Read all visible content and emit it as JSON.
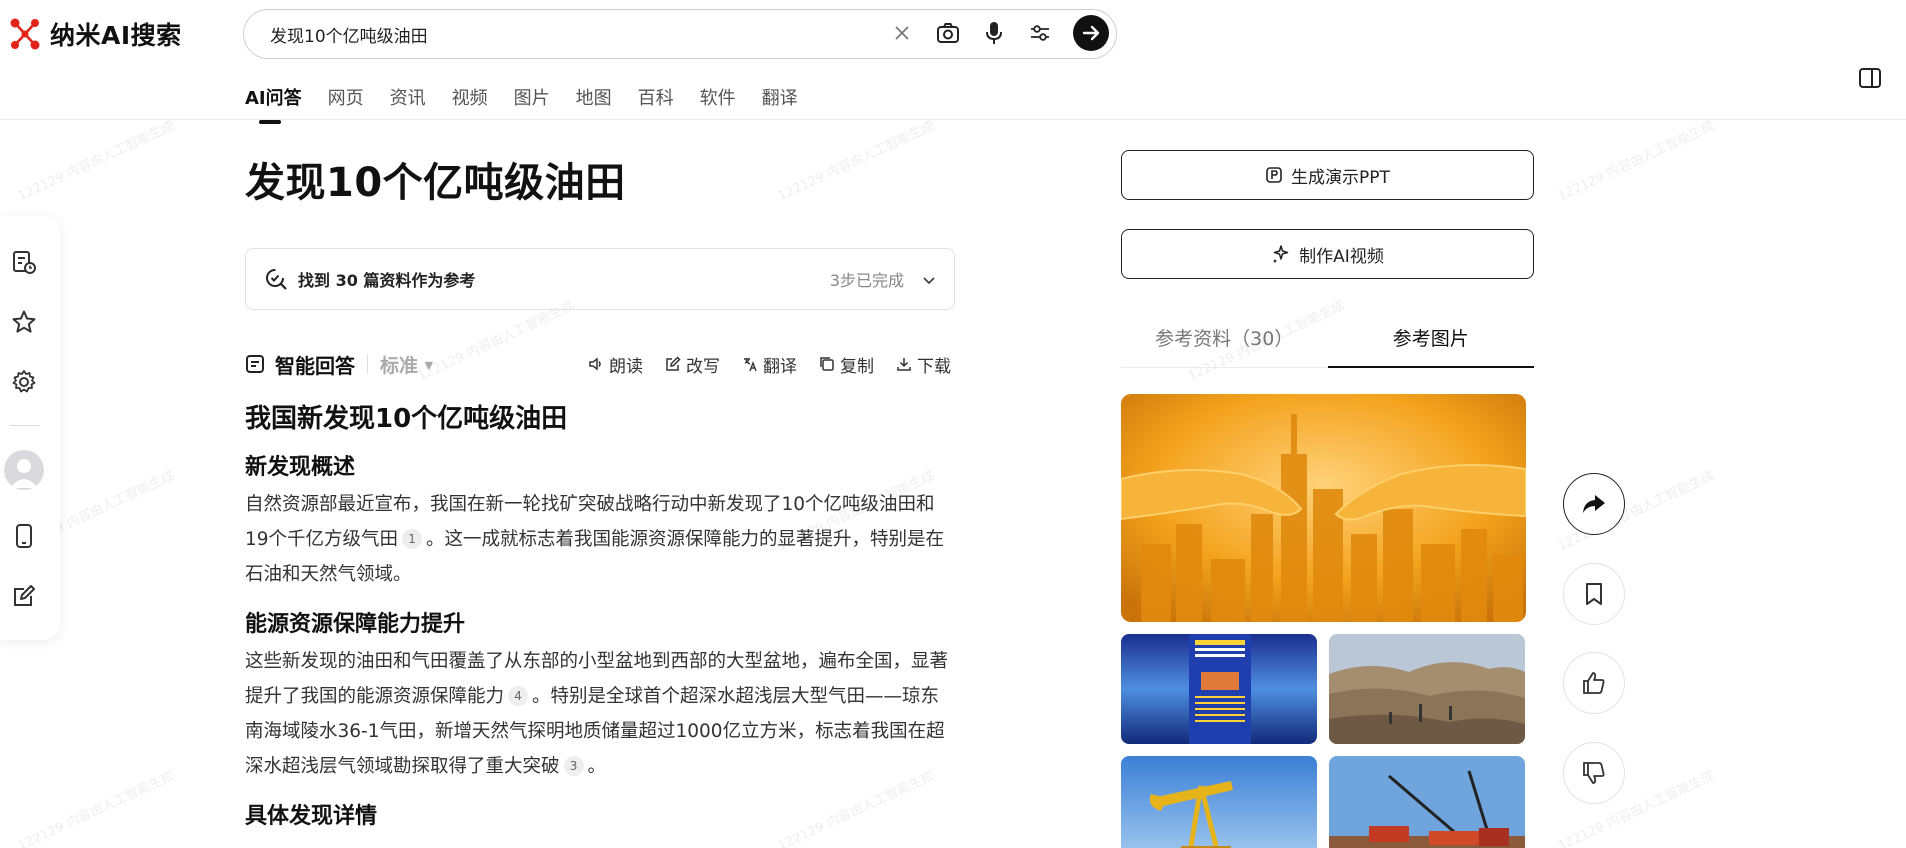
{
  "app": {
    "name": "纳米AI搜索"
  },
  "search": {
    "query": "发现10个亿吨级油田",
    "placeholder": ""
  },
  "tabs": [
    {
      "label": "AI问答",
      "active": true
    },
    {
      "label": "网页"
    },
    {
      "label": "资讯"
    },
    {
      "label": "视频"
    },
    {
      "label": "图片"
    },
    {
      "label": "地图"
    },
    {
      "label": "百科"
    },
    {
      "label": "软件"
    },
    {
      "label": "翻译"
    }
  ],
  "page": {
    "title": "发现10个亿吨级油田"
  },
  "refs": {
    "text": "找到 30 篇资料作为参考",
    "status": "3步已完成"
  },
  "answer": {
    "title": "智能回答",
    "mode": "标准",
    "actions": [
      "朗读",
      "改写",
      "翻译",
      "复制",
      "下载"
    ]
  },
  "content": {
    "h1": "我国新发现10个亿吨级油田",
    "sections": [
      {
        "heading": "新发现概述",
        "text_a": "自然资源部最近宣布，我国在新一轮找矿突破战略行动中新发现了10个亿吨级油田和19个千亿方级气田",
        "cite_a": "1",
        "text_b": "。这一成就标志着我国能源资源保障能力的显著提升，特别是在石油和天然气领域。"
      },
      {
        "heading": "能源资源保障能力提升",
        "text_a": "这些新发现的油田和气田覆盖了从东部的小型盆地到西部的大型盆地，遍布全国，显著提升了我国的能源资源保障能力",
        "cite_a": "4",
        "text_b": "。特别是全球首个超深水超浅层大型气田——琼东南海域陵水36-1气田，新增天然气探明地质储量超过1000亿立方米，标志着我国在超深水超浅层气领域勘探取得了重大突破",
        "cite_b": "3",
        "text_c": "。"
      },
      {
        "heading": "具体发现详情"
      }
    ]
  },
  "right_panel": {
    "btn_ppt": "生成演示PPT",
    "btn_video": "制作AI视频",
    "tab_refs": "参考资料（30）",
    "tab_images": "参考图片"
  },
  "watermark": "122129 内容由人工智能生成"
}
